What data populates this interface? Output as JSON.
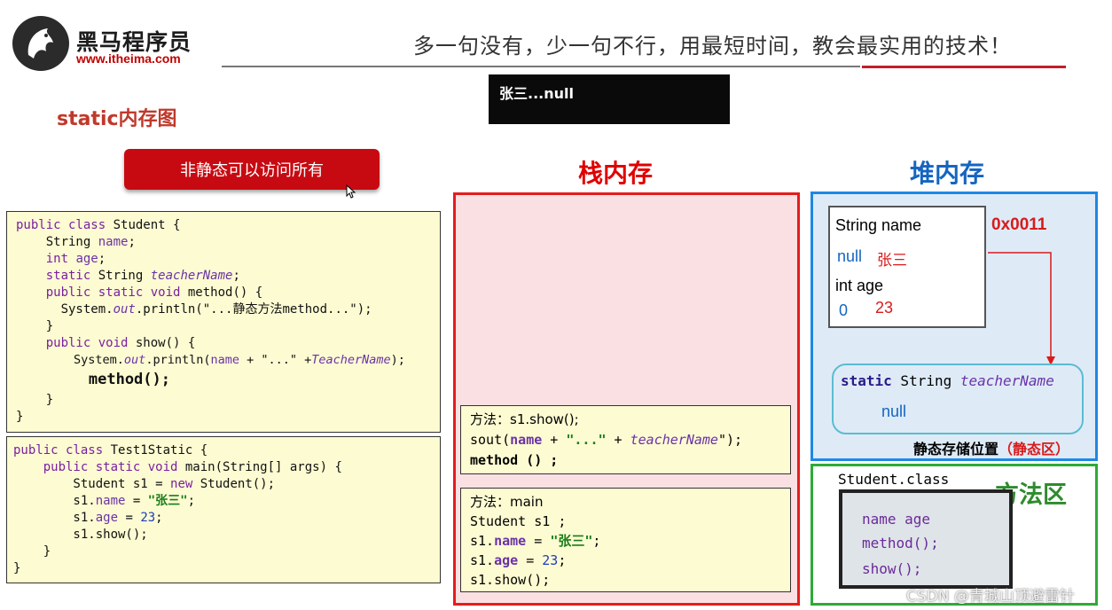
{
  "header": {
    "brand_cn": "黑马程序员",
    "brand_url": "www.itheima.com",
    "slogan": "多一句没有，少一句不行，用最短时间，教会最实用的技术！"
  },
  "console": {
    "output": "张三...null"
  },
  "page_title": "static内存图",
  "red_button": "非静态可以访问所有",
  "student_code": {
    "l1a": "public class",
    "l1b": " Student {",
    "l2a": "    String ",
    "l2b": "name",
    "l2c": ";",
    "l3a": "    int ",
    "l3b": "age",
    "l3c": ";",
    "l4a": "    static ",
    "l4b": "String ",
    "l4c": "teacherName",
    "l4d": ";",
    "l5a": "    public static void ",
    "l5b": "method() {",
    "l6a": "      System.",
    "l6b": "out",
    "l6c": ".println(\"...静态方法method...\");",
    "l7": "    }",
    "l8a": "    public void ",
    "l8b": "show() {",
    "l9a": "        System.",
    "l9b": "out",
    "l9c": ".println(",
    "l9d": "name",
    "l9e": " + \"...\" +",
    "l9f": "TeacherName",
    "l9g": ");",
    "l10": "        method();",
    "l11": "    }",
    "l12": "}"
  },
  "test_code": {
    "l1a": "public class",
    "l1b": " Test1Static {",
    "l2a": "    public static void ",
    "l2b": "main(String[] args) {",
    "l3a": "        Student s1 = ",
    "l3b": "new",
    "l3c": " Student();",
    "l4a": "        s1.",
    "l4b": "name",
    "l4c": " = ",
    "l4d": "\"张三\"",
    "l4e": ";",
    "l5a": "        s1.",
    "l5b": "age",
    "l5c": " = ",
    "l5d": "23",
    "l5e": ";",
    "l6": "        s1.show();",
    "l7": "    }",
    "l8": "}"
  },
  "stack": {
    "title": "栈内存",
    "frame_show": {
      "l1": "方法：s1.show();",
      "l2a": "sout(",
      "l2b": "name",
      "l2c": " + ",
      "l2d": "\"...\"",
      "l2e": " + ",
      "l2f": "teacherName",
      "l2g": "\");",
      "l3": "method () ;"
    },
    "frame_main": {
      "l1": "方法：main",
      "l2": "Student s1 ;",
      "l3a": "s1.",
      "l3b": "name",
      "l3c": " = ",
      "l3d": "\"张三\"",
      "l3e": ";",
      "l4a": "s1.",
      "l4b": "age",
      "l4c": " = ",
      "l4d": "23",
      "l4e": ";",
      "l5": "s1.show();"
    }
  },
  "heap": {
    "title": "堆内存",
    "address": "0x0011",
    "field_name": "String name",
    "name_old": "null",
    "name_new": "张三",
    "field_age": "int age",
    "age_old": "0",
    "age_new": "23",
    "static_a": "static",
    "static_b": " String ",
    "static_c": "teacherName",
    "static_val": "null",
    "static_label_a": "静态存储位置",
    "static_label_b": "（静态区）"
  },
  "method_area": {
    "title": "方法区",
    "class_file": "Student.class",
    "m1": "name age",
    "m2": "method();",
    "m3": "show();"
  },
  "watermark": "CSDN @青城山顶避雷针",
  "colors": {
    "stack_border": "#e51c1c",
    "heap_border": "#1e88e5",
    "method_border": "#2eaa36",
    "button": "#c70a12"
  }
}
